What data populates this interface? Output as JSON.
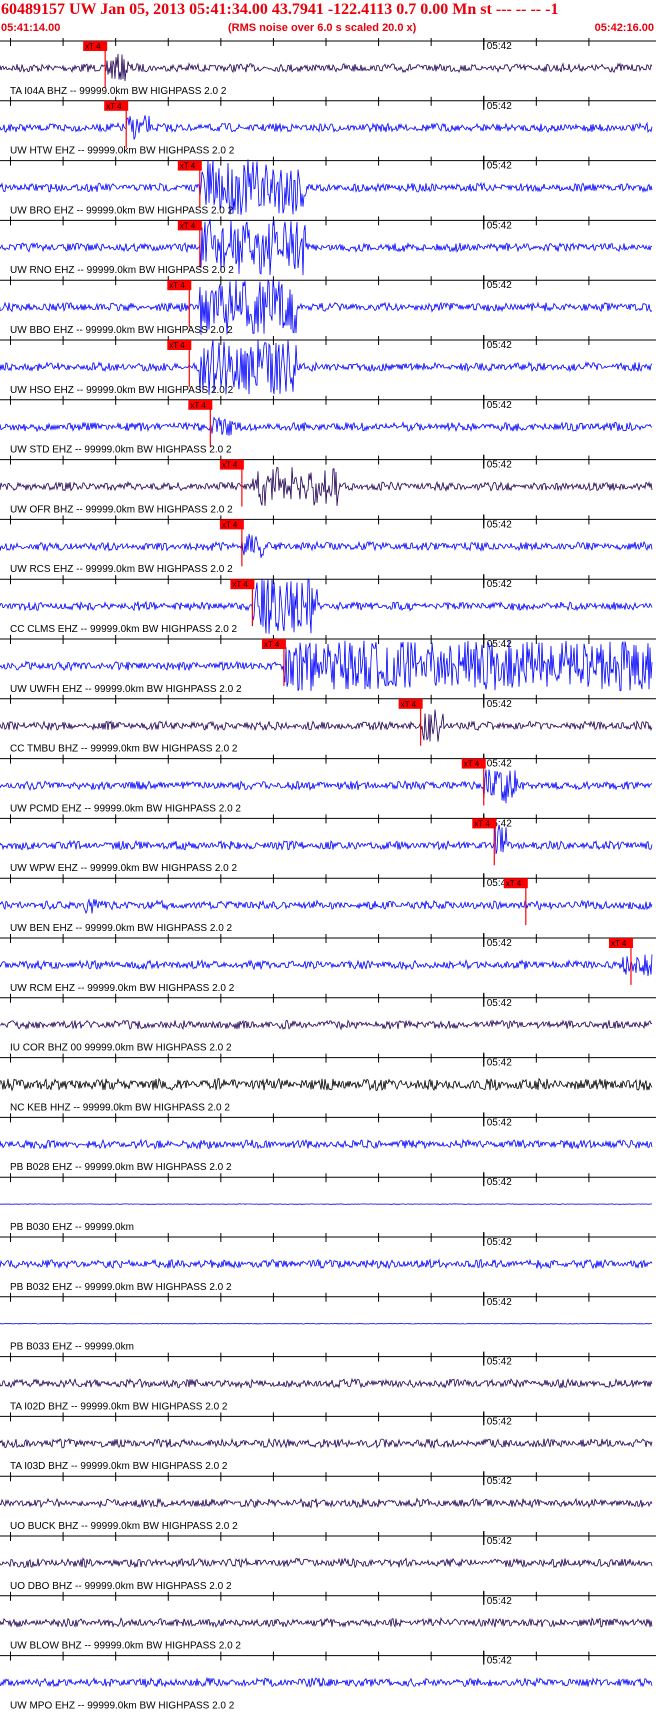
{
  "header": {
    "title": "60489157 UW Jan 05, 2013 05:41:34.00   43.7941 -122.4113  0.7 0.00 Mn st --- -- --  -1",
    "start_time": "05:41:14.00",
    "end_time": "05:42:16.00",
    "noise_note": "(RMS noise over 6.0 s scaled 20.0 x)"
  },
  "colors": {
    "header_red": "#e8000b",
    "trace_blue": "#0000ff",
    "trace_dark": "#220055",
    "trace_black": "#000000",
    "pick_red": "#ff0000"
  },
  "pick_label": "xT 4",
  "chart_data": {
    "type": "seismogram",
    "x_range": [
      "05:41:14.00",
      "05:42:16.00"
    ],
    "tick_label": "05:42",
    "series": [
      {
        "name": "TA I04A BHZ -- 99999.0km BW  HIGHPASS  2.0  2",
        "color": "dark",
        "pick": "05:41:24",
        "event": {
          "start": "05:41:24",
          "end": "05:41:26",
          "amp": 1.0
        }
      },
      {
        "name": "UW HTW EHZ -- 99999.0km BW  HIGHPASS  2.0  2",
        "color": "blue",
        "pick": "05:41:26",
        "event": {
          "start": "05:41:26",
          "end": "05:41:28",
          "amp": 0.9
        }
      },
      {
        "name": "UW BRO EHZ -- 99999.0km BW  HIGHPASS  2.0  2",
        "color": "blue",
        "pick": "05:41:33",
        "event": {
          "start": "05:41:33",
          "end": "05:41:43",
          "amp": 2.0
        }
      },
      {
        "name": "UW RNO EHZ -- 99999.0km BW  HIGHPASS  2.0  2",
        "color": "blue",
        "pick": "05:41:33",
        "event": {
          "start": "05:41:33",
          "end": "05:41:43",
          "amp": 2.0
        }
      },
      {
        "name": "UW BBO EHZ -- 99999.0km BW  HIGHPASS  2.0  2",
        "color": "blue",
        "pick": "05:41:32",
        "event": {
          "start": "05:41:33",
          "end": "05:41:42",
          "amp": 2.0
        }
      },
      {
        "name": "UW HSO EHZ -- 99999.0km BW  HIGHPASS  2.0  2",
        "color": "blue",
        "pick": "05:41:32",
        "event": {
          "start": "05:41:33",
          "end": "05:41:42",
          "amp": 2.0
        }
      },
      {
        "name": "UW STD EHZ -- 99999.0km BW  HIGHPASS  2.0  2",
        "color": "blue",
        "pick": "05:41:34",
        "event": {
          "start": "05:41:34",
          "end": "05:41:36",
          "amp": 0.7
        }
      },
      {
        "name": "UW OFR BHZ -- 99999.0km BW  HIGHPASS  2.0  2",
        "color": "dark",
        "pick": "05:41:37",
        "event": {
          "start": "05:41:38",
          "end": "05:41:46",
          "amp": 1.4
        }
      },
      {
        "name": "UW RCS EHZ -- 99999.0km BW  HIGHPASS  2.0  2",
        "color": "blue",
        "pick": "05:41:37",
        "event": {
          "start": "05:41:37",
          "end": "05:41:39",
          "amp": 0.9
        }
      },
      {
        "name": "CC CLMS EHZ -- 99999.0km BW  HIGHPASS  2.0  2",
        "color": "blue",
        "pick": "05:41:38",
        "event": {
          "start": "05:41:38",
          "end": "05:41:44",
          "amp": 2.0
        }
      },
      {
        "name": "UW UWFH EHZ -- 99999.0km BW  HIGHPASS  2.0  2",
        "color": "blue",
        "pick": "05:41:41",
        "event": {
          "start": "05:41:41",
          "end": "05:42:16",
          "amp": 1.8
        }
      },
      {
        "name": "CC TMBU BHZ -- 99999.0km BW  HIGHPASS  2.0  2",
        "color": "dark",
        "pick": "05:41:54",
        "event": {
          "start": "05:41:54",
          "end": "05:41:56",
          "amp": 1.2
        }
      },
      {
        "name": "UW PCMD EHZ -- 99999.0km BW  HIGHPASS  2.0  2",
        "color": "blue",
        "pick": "05:42:00",
        "event": {
          "start": "05:42:00",
          "end": "05:42:03",
          "amp": 1.3
        }
      },
      {
        "name": "UW WPW EHZ -- 99999.0km BW  HIGHPASS  2.0  2",
        "color": "blue",
        "pick": "05:42:01",
        "event": {
          "start": "05:42:01",
          "end": "05:42:02",
          "amp": 1.6
        }
      },
      {
        "name": "UW BEN EHZ -- 99999.0km BW  HIGHPASS  2.0  2",
        "color": "blue",
        "pick": "05:42:04",
        "event": {
          "start": "05:41:22",
          "end": "05:41:23",
          "amp": 0.6
        }
      },
      {
        "name": "UW RCM EHZ -- 99999.0km BW  HIGHPASS  2.0  2",
        "color": "blue",
        "pick": "05:42:14",
        "event": {
          "start": "05:42:13",
          "end": "05:42:16",
          "amp": 0.8
        }
      },
      {
        "name": "IU COR BHZ 00 99999.0km BW  HIGHPASS  2.0  2",
        "color": "dark"
      },
      {
        "name": "NC KEB HHZ -- 99999.0km BW  HIGHPASS  2.0  2",
        "color": "black"
      },
      {
        "name": "PB B028 EHZ -- 99999.0km BW  HIGHPASS  2.0  2",
        "color": "blue"
      },
      {
        "name": "PB B030 EHZ -- 99999.0km",
        "color": "blue",
        "flat": true
      },
      {
        "name": "PB B032 EHZ -- 99999.0km BW  HIGHPASS  2.0  2",
        "color": "blue"
      },
      {
        "name": "PB B033 EHZ -- 99999.0km",
        "color": "blue",
        "flat": true
      },
      {
        "name": "TA I02D BHZ -- 99999.0km BW  HIGHPASS  2.0  2",
        "color": "dark"
      },
      {
        "name": "TA I03D BHZ -- 99999.0km BW  HIGHPASS  2.0  2",
        "color": "dark"
      },
      {
        "name": "UO BUCK BHZ -- 99999.0km BW  HIGHPASS  2.0  2",
        "color": "dark"
      },
      {
        "name": "UO DBO BHZ -- 99999.0km BW  HIGHPASS  2.0  2",
        "color": "dark"
      },
      {
        "name": "UW BLOW BHZ -- 99999.0km BW  HIGHPASS  2.0  2",
        "color": "dark"
      },
      {
        "name": "UW MPO EHZ -- 99999.0km BW  HIGHPASS  2.0  2",
        "color": "blue"
      }
    ]
  }
}
